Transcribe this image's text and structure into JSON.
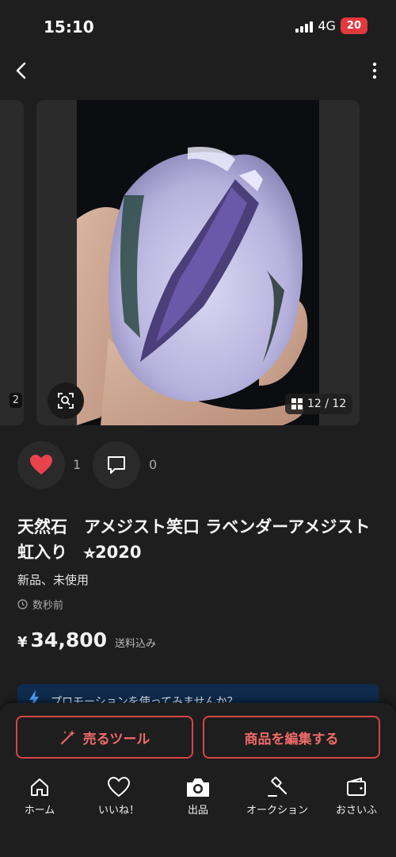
{
  "status": {
    "time": "15:10",
    "network": "4G",
    "battery": "20"
  },
  "gallery": {
    "prev_number": "2",
    "counter": "12 / 12"
  },
  "actions": {
    "likes": "1",
    "comments": "0"
  },
  "item": {
    "title": "天然石　アメジスト笑口 ラベンダーアメジスト　虹入り　⭐︎2020",
    "condition": "新品、未使用",
    "posted": "数秒前",
    "currency": "¥",
    "price": "34,800",
    "shipping": "送料込み"
  },
  "promo": {
    "text": "プロモーションを使ってみませんか？"
  },
  "buttons": {
    "sell_tool": "売るツール",
    "edit_item": "商品を編集する"
  },
  "tabs": [
    {
      "label": "ホーム",
      "icon": "home-icon"
    },
    {
      "label": "いいね！",
      "icon": "heart-icon"
    },
    {
      "label": "出品",
      "icon": "camera-icon"
    },
    {
      "label": "オークション",
      "icon": "gavel-icon"
    },
    {
      "label": "おさいふ",
      "icon": "wallet-icon"
    }
  ],
  "colors": {
    "accent": "#e0393e",
    "like": "#e8434b",
    "button_border": "#d64545",
    "promo_bg": "#0f2c4e"
  }
}
